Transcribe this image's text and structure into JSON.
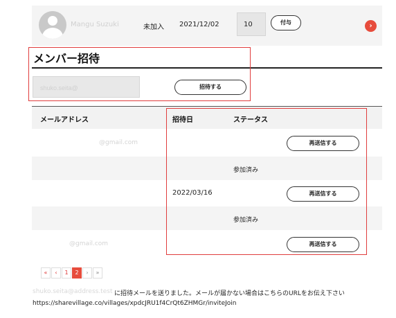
{
  "member": {
    "name": "Mangu Suzuki",
    "status": "未加入",
    "date": "2021/12/02",
    "quantity": "10",
    "grant_label": "付与"
  },
  "invite_section": {
    "title": "メンバー招待",
    "email_value": "shuko.seita@",
    "invite_button": "招待する"
  },
  "table": {
    "headers": {
      "email": "メールアドレス",
      "date": "招待日",
      "status": "ステータス"
    },
    "rows": [
      {
        "email": "@gmail.com",
        "date": "",
        "status": "",
        "action": "再送信する"
      },
      {
        "email": "",
        "date": "",
        "status": "参加済み",
        "action": ""
      },
      {
        "email": "",
        "date": "2022/03/16",
        "status": "",
        "action": "再送信する"
      },
      {
        "email": "",
        "date": "",
        "status": "参加済み",
        "action": ""
      },
      {
        "email": "@gmail.com",
        "date": "",
        "status": "",
        "action": "再送信する"
      }
    ]
  },
  "pagination": {
    "first": "«",
    "prev": "‹",
    "pages": [
      "1",
      "2"
    ],
    "current": "2",
    "next": "›",
    "last": "»"
  },
  "notice": {
    "prefix": "shuko.seita@address.test",
    "message": "に招待メールを送りました。メールが届かない場合はこちらのURLをお伝え下さい",
    "url": "https://sharevillage.co/villages/xpdcJRU1f4CrQt6ZHMGr/inviteJoin"
  },
  "colors": {
    "accent": "#e74c3c",
    "highlight_border": "#e03c3c"
  }
}
